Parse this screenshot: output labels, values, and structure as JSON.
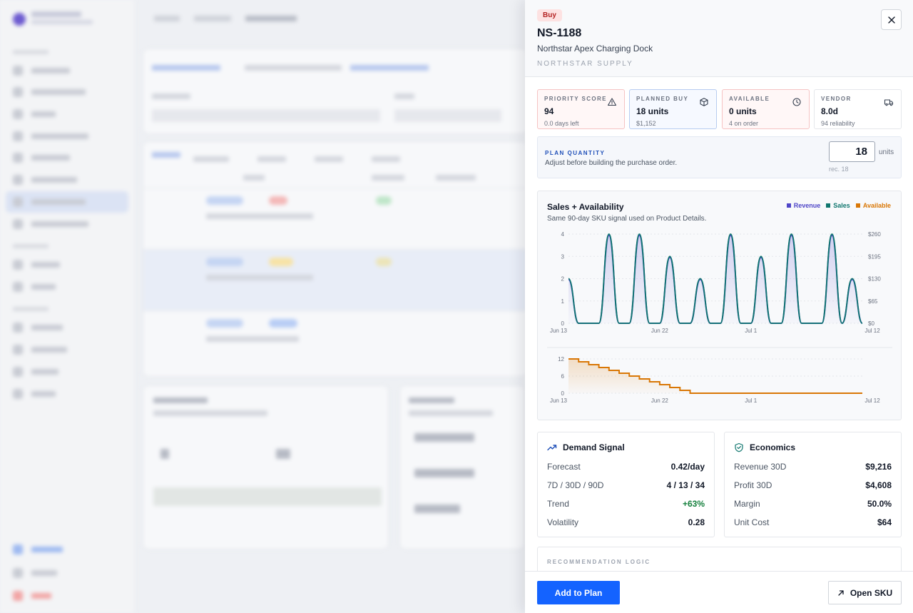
{
  "drawer": {
    "badge": "Buy",
    "sku": "NS-1188",
    "product_name": "Northstar Apex Charging Dock",
    "vendor_name": "NORTHSTAR SUPPLY"
  },
  "kpis": [
    {
      "label": "PRIORITY SCORE",
      "value": "94",
      "sub": "0.0 days left",
      "icon": "warning-icon"
    },
    {
      "label": "PLANNED BUY",
      "value": "18 units",
      "sub": "$1,152",
      "icon": "box-icon"
    },
    {
      "label": "AVAILABLE",
      "value": "0 units",
      "sub": "4 on order",
      "icon": "clock-icon"
    },
    {
      "label": "VENDOR",
      "value": "8.0d",
      "sub": "94 reliability",
      "icon": "truck-icon"
    }
  ],
  "plan_quantity": {
    "title": "PLAN QUANTITY",
    "subtitle": "Adjust before building the purchase order.",
    "value": "18",
    "unit": "units",
    "recommended": "rec. 18"
  },
  "chart_card": {
    "title": "Sales + Availability",
    "subtitle": "Same 90-day SKU signal used on Product Details.",
    "legend": [
      "Revenue",
      "Sales",
      "Available"
    ]
  },
  "colors": {
    "revenue": "#4f46c8",
    "sales": "#0f766e",
    "available": "#d97706",
    "accent": "#1463ff",
    "buy_badge": "#b42323"
  },
  "chart_data": [
    {
      "type": "line",
      "x_ticks": [
        "Jun 13",
        "Jun 22",
        "Jul 1",
        "Jul 12"
      ],
      "y_left_ticks": [
        "0",
        "1",
        "2",
        "3",
        "4"
      ],
      "y_right_ticks": [
        "$0",
        "$65",
        "$130",
        "$195",
        "$260"
      ],
      "ylim_left": [
        0,
        4
      ],
      "ylim_right": [
        0,
        260
      ],
      "x": [
        "Jun 13",
        "Jun 14",
        "Jun 15",
        "Jun 16",
        "Jun 17",
        "Jun 18",
        "Jun 19",
        "Jun 20",
        "Jun 21",
        "Jun 22",
        "Jun 23",
        "Jun 24",
        "Jun 25",
        "Jun 26",
        "Jun 27",
        "Jun 28",
        "Jun 29",
        "Jun 30",
        "Jul 1",
        "Jul 2",
        "Jul 3",
        "Jul 4",
        "Jul 5",
        "Jul 6",
        "Jul 7",
        "Jul 8",
        "Jul 9",
        "Jul 10",
        "Jul 11",
        "Jul 12"
      ],
      "series": [
        {
          "name": "Revenue",
          "axis": "right",
          "values": [
            128,
            0,
            0,
            0,
            256,
            0,
            0,
            256,
            0,
            0,
            192,
            0,
            0,
            128,
            0,
            0,
            256,
            0,
            0,
            192,
            0,
            0,
            256,
            0,
            0,
            0,
            256,
            0,
            128,
            0
          ]
        },
        {
          "name": "Sales",
          "axis": "left",
          "values": [
            2,
            0,
            0,
            0,
            4,
            0,
            0,
            4,
            0,
            0,
            3,
            0,
            0,
            2,
            0,
            0,
            4,
            0,
            0,
            3,
            0,
            0,
            4,
            0,
            0,
            0,
            4,
            0,
            2,
            0
          ]
        }
      ]
    },
    {
      "type": "line",
      "x_ticks": [
        "Jun 13",
        "Jun 22",
        "Jul 1",
        "Jul 12"
      ],
      "y_ticks": [
        "0",
        "6",
        "12"
      ],
      "ylim": [
        0,
        12
      ],
      "x": [
        "Jun 13",
        "Jun 14",
        "Jun 15",
        "Jun 16",
        "Jun 17",
        "Jun 18",
        "Jun 19",
        "Jun 20",
        "Jun 21",
        "Jun 22",
        "Jun 23",
        "Jun 24",
        "Jun 25",
        "Jun 26",
        "Jun 27",
        "Jun 28",
        "Jun 29",
        "Jun 30",
        "Jul 1",
        "Jul 2",
        "Jul 3",
        "Jul 4",
        "Jul 5",
        "Jul 6",
        "Jul 7",
        "Jul 8",
        "Jul 9",
        "Jul 10",
        "Jul 11",
        "Jul 12"
      ],
      "series": [
        {
          "name": "Available",
          "values": [
            12,
            11,
            10,
            9,
            8,
            7,
            6,
            5,
            4,
            3,
            2,
            1,
            0,
            0,
            0,
            0,
            0,
            0,
            0,
            0,
            0,
            0,
            0,
            0,
            0,
            0,
            0,
            0,
            0,
            0
          ]
        }
      ]
    }
  ],
  "demand": {
    "title": "Demand Signal",
    "rows": [
      {
        "label": "Forecast",
        "value": "0.42/day"
      },
      {
        "label": "7D / 30D / 90D",
        "value": "4 / 13 / 34"
      },
      {
        "label": "Trend",
        "value": "+63%"
      },
      {
        "label": "Volatility",
        "value": "0.28"
      }
    ]
  },
  "economics": {
    "title": "Economics",
    "rows": [
      {
        "label": "Revenue 30D",
        "value": "$9,216"
      },
      {
        "label": "Profit 30D",
        "value": "$4,608"
      },
      {
        "label": "Margin",
        "value": "50.0%"
      },
      {
        "label": "Unit Cost",
        "value": "$64"
      }
    ]
  },
  "logic": {
    "title": "RECOMMENDATION LOGIC"
  },
  "footer": {
    "add_label": "Add to Plan",
    "open_label": "Open SKU"
  }
}
